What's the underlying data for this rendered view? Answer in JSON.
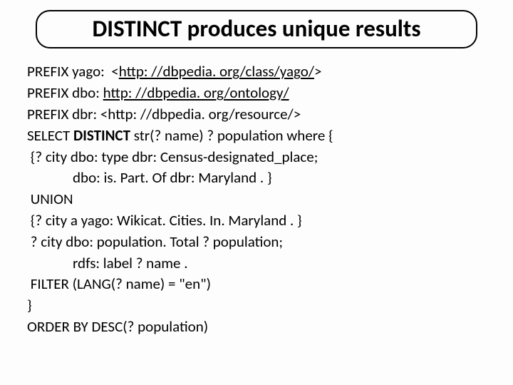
{
  "title": "DISTINCT produces unique results",
  "lines": {
    "l1a": "PREFIX yago:  <",
    "l1b": "http: //dbpedia. org/class/yago/",
    "l1c": ">",
    "l2a": "PREFIX dbo: ",
    "l2b": "http: //dbpedia. org/ontology/",
    "l3": "PREFIX dbr: <http: //dbpedia. org/resource/>",
    "l4a": "SELECT ",
    "l4b": "DISTINCT",
    "l4c": " str(? name) ? population where {",
    "l5": " {? city dbo: type dbr: Census-designated_place;",
    "l6": "dbo: is. Part. Of dbr: Maryland . }",
    "l7": " UNION",
    "l8": " {? city a yago: Wikicat. Cities. In. Maryland . }",
    "l9": " ? city dbo: population. Total ? population;",
    "l10": "rdfs: label ? name .",
    "l11": " FILTER (LANG(? name) = \"en\")",
    "l12": "}",
    "l13": "ORDER BY DESC(? population)"
  }
}
